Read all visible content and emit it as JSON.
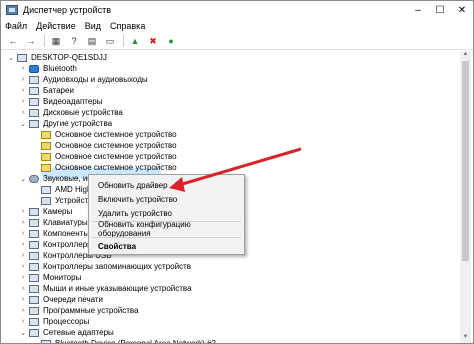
{
  "window": {
    "title": "Диспетчер устройств",
    "minimize": "–",
    "maximize": "☐",
    "close": "✕"
  },
  "menu": [
    "Файл",
    "Действие",
    "Вид",
    "Справка"
  ],
  "toolbar": {
    "back": "←",
    "forward": "→",
    "properties": "▦",
    "help": "?",
    "scan": "▤",
    "update": "▭",
    "driver": "▲",
    "remove": "✖",
    "enable": "●"
  },
  "tree": {
    "root": "DESKTOP-QE1SDJJ",
    "items": [
      {
        "label": "Bluetooth",
        "icon": "bluetooth-icon"
      },
      {
        "label": "Аудиовходы и аудиовыходы",
        "icon": "audio-icon"
      },
      {
        "label": "Батареи",
        "icon": "battery-icon"
      },
      {
        "label": "Видеоадаптеры",
        "icon": "display-adapter-icon"
      },
      {
        "label": "Дисковые устройства",
        "icon": "disk-icon"
      },
      {
        "label": "Другие устройства",
        "icon": "other-devices-icon"
      },
      {
        "label": "Основное системное устройство",
        "icon": "warning-device-icon"
      },
      {
        "label": "Основное системное устройство",
        "icon": "warning-device-icon"
      },
      {
        "label": "Основное системное устройство",
        "icon": "warning-device-icon"
      },
      {
        "label": "Основное системное устройство",
        "icon": "warning-device-icon"
      },
      {
        "label": "Звуковые, игровые и видеоустройства",
        "icon": "sound-icon"
      },
      {
        "label": "AMD High Definition Audio Device",
        "icon": "speaker-icon"
      },
      {
        "label": "Устройство с поддержкой High Definition Audio",
        "icon": "speaker-icon"
      },
      {
        "label": "Камеры",
        "icon": "camera-icon"
      },
      {
        "label": "Клавиатуры",
        "icon": "keyboard-icon"
      },
      {
        "label": "Компоненты программного обеспечения",
        "icon": "component-icon"
      },
      {
        "label": "Контроллеры IDE ATA/ATAPI",
        "icon": "controller-icon"
      },
      {
        "label": "Контроллеры USB",
        "icon": "usb-icon"
      },
      {
        "label": "Контроллеры запоминающих устройств",
        "icon": "storage-icon"
      },
      {
        "label": "Мониторы",
        "icon": "monitor-icon"
      },
      {
        "label": "Мыши и иные указывающие устройства",
        "icon": "mouse-icon"
      },
      {
        "label": "Очереди печати",
        "icon": "printer-icon"
      },
      {
        "label": "Программные устройства",
        "icon": "software-device-icon"
      },
      {
        "label": "Процессоры",
        "icon": "cpu-icon"
      },
      {
        "label": "Сетевые адаптеры",
        "icon": "network-icon"
      },
      {
        "label": "Bluetooth Device (Personal Area Network) #2",
        "icon": "network-icon"
      }
    ]
  },
  "context_menu": {
    "update": "Обновить драйвер",
    "enable": "Включить устройство",
    "remove": "Удалить устройство",
    "scan": "Обновить конфигурацию оборудования",
    "props": "Свойства"
  },
  "colors": {
    "arrow": "#d9232a",
    "selection": "#cce8ff"
  }
}
